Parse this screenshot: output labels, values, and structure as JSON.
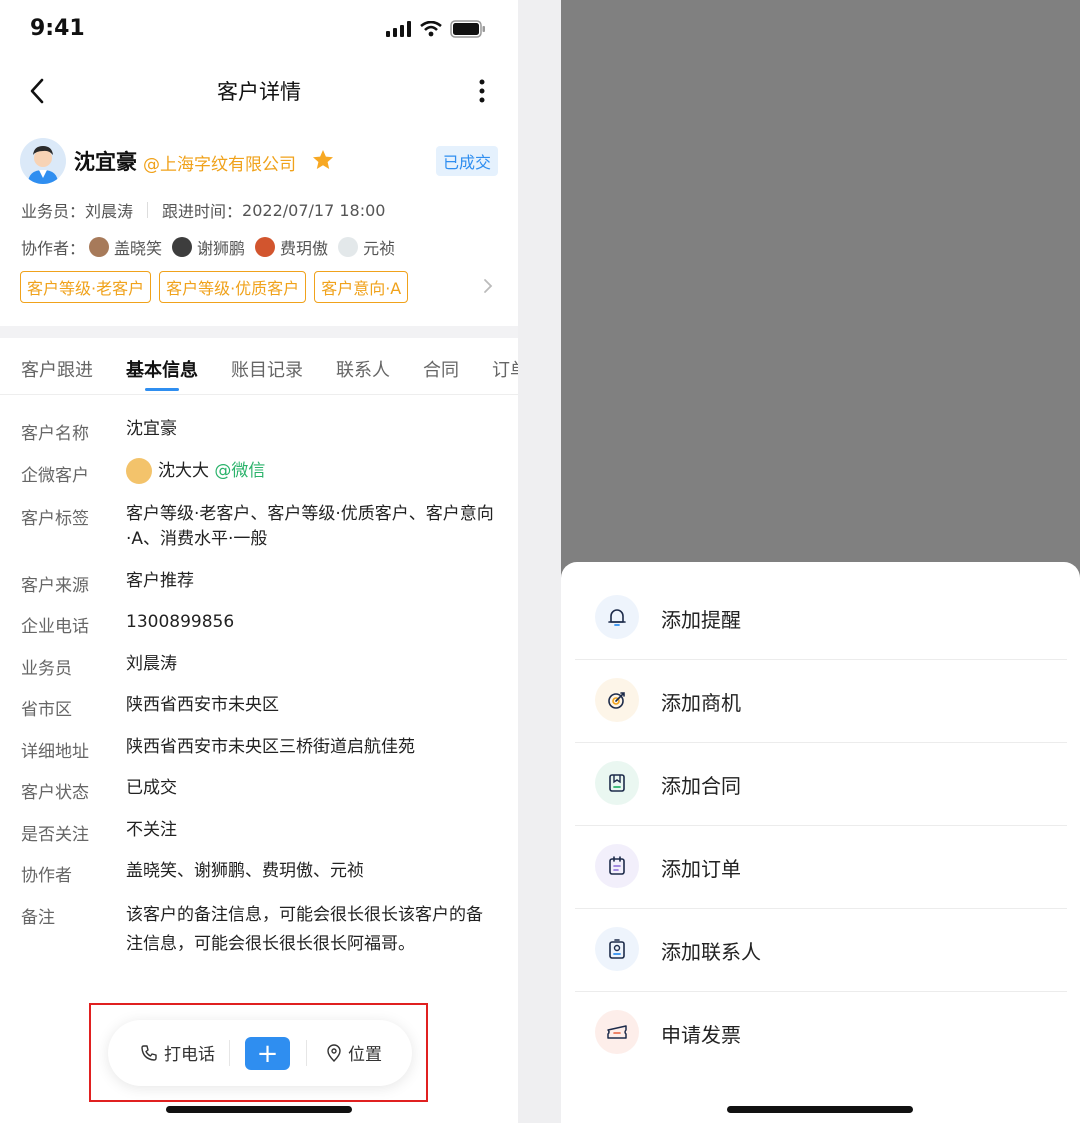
{
  "status_bar": {
    "time": "9:41"
  },
  "nav": {
    "title": "客户详情"
  },
  "customer": {
    "name": "沈宜豪",
    "company": "@上海字纹有限公司",
    "badge": "已成交",
    "salesperson_label": "业务员：",
    "salesperson": "刘晨涛",
    "followup_label": "跟进时间：",
    "followup_time": "2022/07/17 18:00",
    "collaborators_label": "协作者：",
    "collaborators": [
      "盖晓笑",
      "谢狮鹏",
      "费玥傲",
      "元祯"
    ],
    "tags": [
      "客户等级·老客户",
      "客户等级·优质客户",
      "客户意向·A"
    ]
  },
  "tabs": [
    "客户跟进",
    "基本信息",
    "账目记录",
    "联系人",
    "合同",
    "订单"
  ],
  "info": [
    {
      "label": "客户名称",
      "value": "沈宜豪"
    },
    {
      "label": "企微客户",
      "value": "沈大大",
      "extra": "@微信"
    },
    {
      "label": "客户标签",
      "value": "客户等级·老客户、客户等级·优质客户、客户意向·A、消费水平·一般"
    },
    {
      "label": "客户来源",
      "value": "客户推荐"
    },
    {
      "label": "企业电话",
      "value": "1300899856"
    },
    {
      "label": "业务员",
      "value": "刘晨涛"
    },
    {
      "label": "省市区",
      "value": "陕西省西安市未央区"
    },
    {
      "label": "详细地址",
      "value": "陕西省西安市未央区三桥街道启航佳苑"
    },
    {
      "label": "客户状态",
      "value": "已成交"
    },
    {
      "label": "是否关注",
      "value": "不关注"
    },
    {
      "label": "协作者",
      "value": "盖晓笑、谢狮鹏、费玥傲、元祯"
    },
    {
      "label": "备注",
      "value": "该客户的备注信息，可能会很长很长该客户的备注信息，可能会很长很长很长阿福哥。"
    }
  ],
  "action_bar": {
    "call": "打电话",
    "plus": "+",
    "location": "位置"
  },
  "sheet": {
    "items": [
      {
        "label": "添加提醒",
        "icon": "bell-icon",
        "color": "#eef4fc"
      },
      {
        "label": "添加商机",
        "icon": "target-icon",
        "color": "#fdf5e8"
      },
      {
        "label": "添加合同",
        "icon": "contract-icon",
        "color": "#eaf7f1"
      },
      {
        "label": "添加订单",
        "icon": "order-icon",
        "color": "#f2effb"
      },
      {
        "label": "添加联系人",
        "icon": "contact-icon",
        "color": "#eef4fc"
      },
      {
        "label": "申请发票",
        "icon": "invoice-icon",
        "color": "#fdeeea"
      }
    ]
  },
  "colors": {
    "accent": "#2f8ef0",
    "tag": "#f0a21b",
    "wechat": "#2bb36b"
  }
}
